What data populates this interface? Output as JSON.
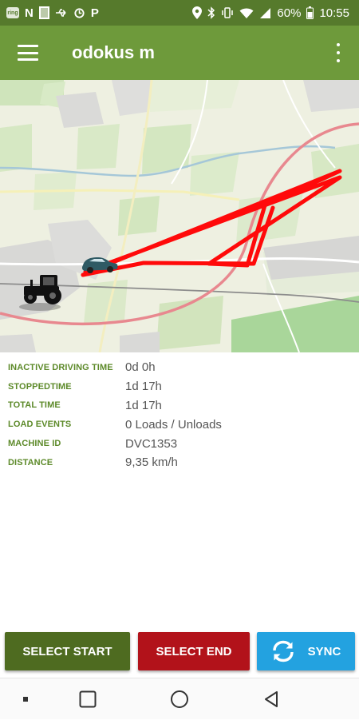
{
  "status_bar": {
    "left_icons": [
      "ring-icon",
      "n-icon",
      "sim-icon",
      "usb-icon",
      "sync-icon",
      "parking-icon"
    ],
    "ring_label": "ring",
    "n_label": "N",
    "p_label": "P",
    "battery": "60%",
    "time": "10:55"
  },
  "app_bar": {
    "title": "odokus m"
  },
  "details": [
    {
      "label": "INACTIVE DRIVING TIME",
      "value": "0d 0h"
    },
    {
      "label": "STOPPEDTIME",
      "value": "1d 17h"
    },
    {
      "label": "TOTAL TIME",
      "value": "1d 17h"
    },
    {
      "label": "LOAD EVENTS",
      "value": "0 Loads / Unloads"
    },
    {
      "label": "MACHINE ID",
      "value": "DVC1353"
    },
    {
      "label": "DISTANCE",
      "value": "9,35 km/h"
    }
  ],
  "buttons": {
    "select_start": "SELECT START",
    "select_end": "SELECT END",
    "sync": "SYNC"
  },
  "colors": {
    "app_bar": "#6e9a3b",
    "status_bar": "#567a2c",
    "label_green": "#5d8a2a",
    "start_button": "#4e6b20",
    "end_button": "#b2121a",
    "sync_button": "#23a2e0",
    "track": "#ff0000"
  }
}
